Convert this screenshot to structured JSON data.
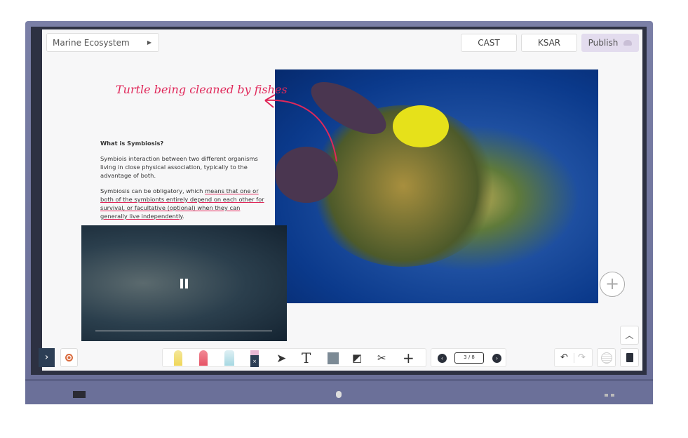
{
  "header": {
    "title": "Marine Ecosystem",
    "cast_label": "CAST",
    "ksar_label": "KSAR",
    "publish_label": "Publish"
  },
  "annotation": {
    "handwritten": "Turtle being cleaned by fishes"
  },
  "content": {
    "heading": "What is Symbiosis?",
    "paragraph1": "Symbiois interaction between two different organisms living in close physical association, typically to the advantage of both.",
    "paragraph2_plain": "Symbiosis can be obligatory, which ",
    "paragraph2_underlined": "means that one or both of the symbionts entirely depend on each other for survival, or facultative (optional) when they can generally live independently",
    "paragraph2_end": "."
  },
  "video": {
    "state": "playing",
    "pause_icon": "pause-icon"
  },
  "pagination": {
    "indicator": "3 / 8"
  },
  "colors": {
    "accent_pink": "#e0285a",
    "publish_bg": "#e3dcee",
    "sidebar_toggle": "#2c3e55"
  }
}
